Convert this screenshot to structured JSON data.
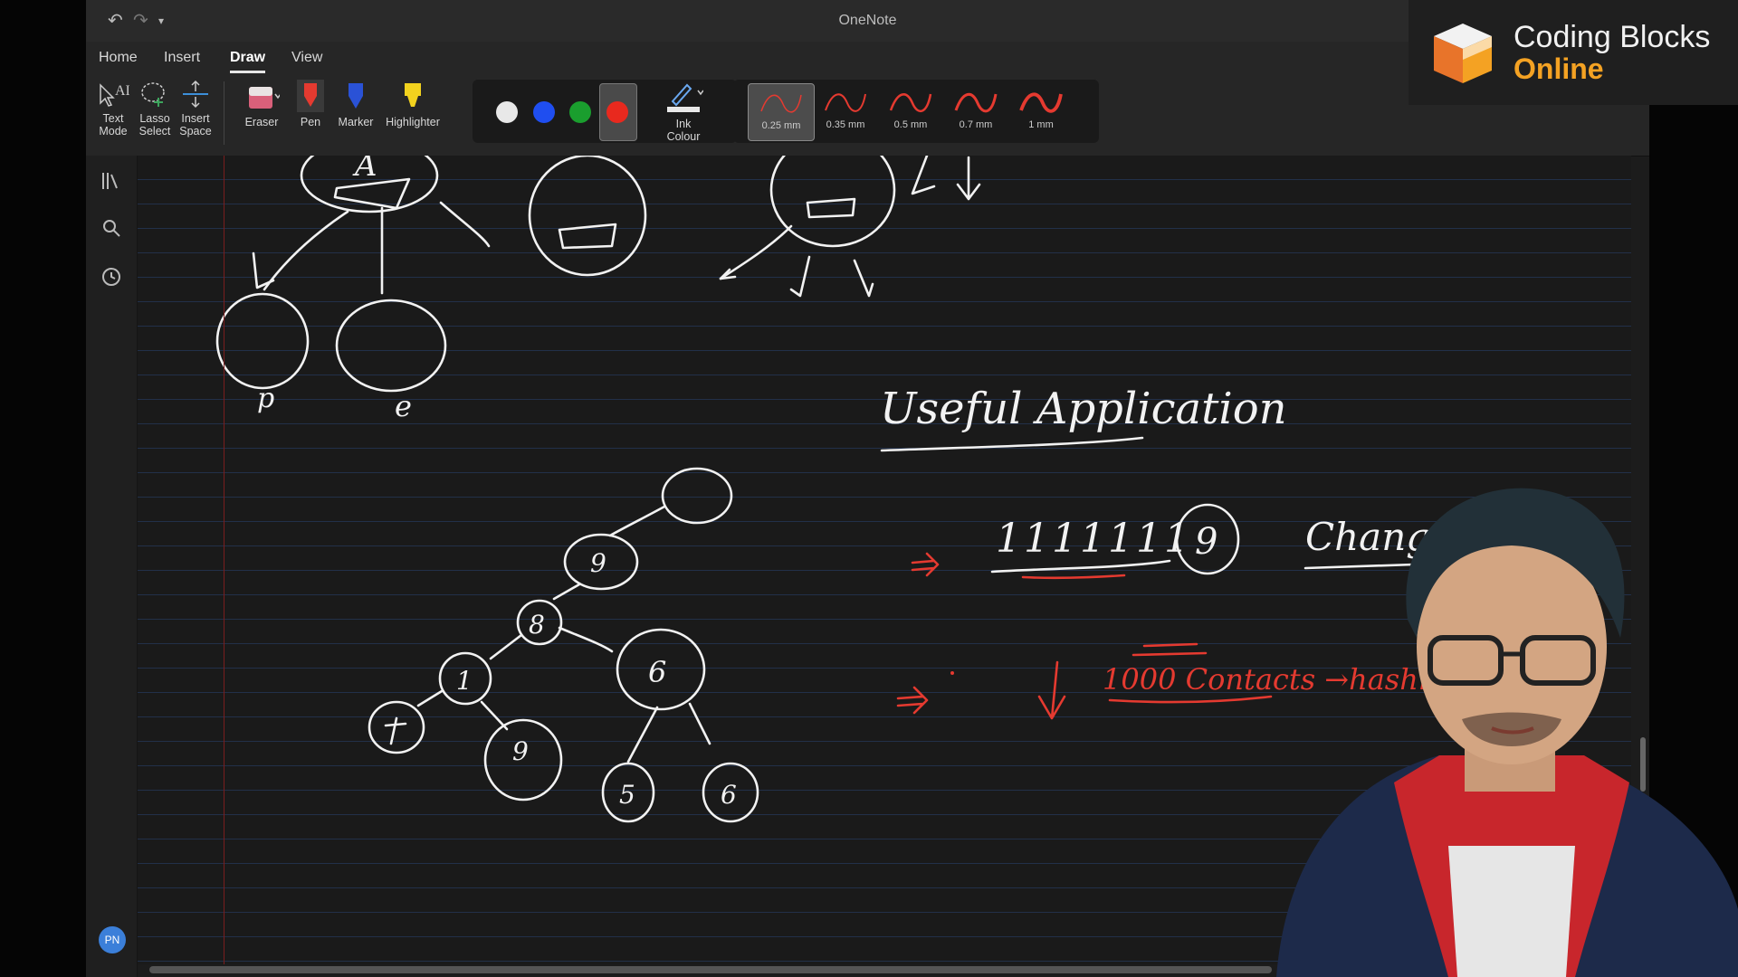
{
  "app": {
    "title": "OneNote"
  },
  "ribbon_tabs": [
    "Home",
    "Insert",
    "Draw",
    "View"
  ],
  "active_tab": "Draw",
  "tools": {
    "text_mode": [
      "Text",
      "Mode"
    ],
    "lasso_select": [
      "Lasso",
      "Select"
    ],
    "insert_space": [
      "Insert",
      "Space"
    ],
    "eraser": "Eraser",
    "pen": "Pen",
    "marker": "Marker",
    "highlighter": "Highlighter",
    "ink_colour": [
      "Ink",
      "Colour"
    ]
  },
  "ink_colors": [
    {
      "name": "white",
      "hex": "#e8e8e8"
    },
    {
      "name": "blue",
      "hex": "#1f4ef0"
    },
    {
      "name": "green",
      "hex": "#1a9e2e"
    },
    {
      "name": "red",
      "hex": "#e8291e"
    }
  ],
  "selected_color": "red",
  "pen_sizes": [
    "0.25 mm",
    "0.35 mm",
    "0.5 mm",
    "0.7 mm",
    "1 mm"
  ],
  "selected_pen_size": "0.25 mm",
  "user_avatar": "PN",
  "notes": {
    "tree_nodes": [
      "A",
      "9",
      "8",
      "1",
      "6",
      "9",
      "5",
      "6"
    ],
    "tree_leaf_labels": [
      "p",
      "e"
    ],
    "heading": "Useful Application",
    "line1_digits": "1111111",
    "line1_circled": "9",
    "line1_word": "Chang",
    "line2": "1000 Contacts →hashm"
  },
  "branding": {
    "name": "Coding Blocks",
    "sub": "Online",
    "accent": "#f4a223"
  }
}
